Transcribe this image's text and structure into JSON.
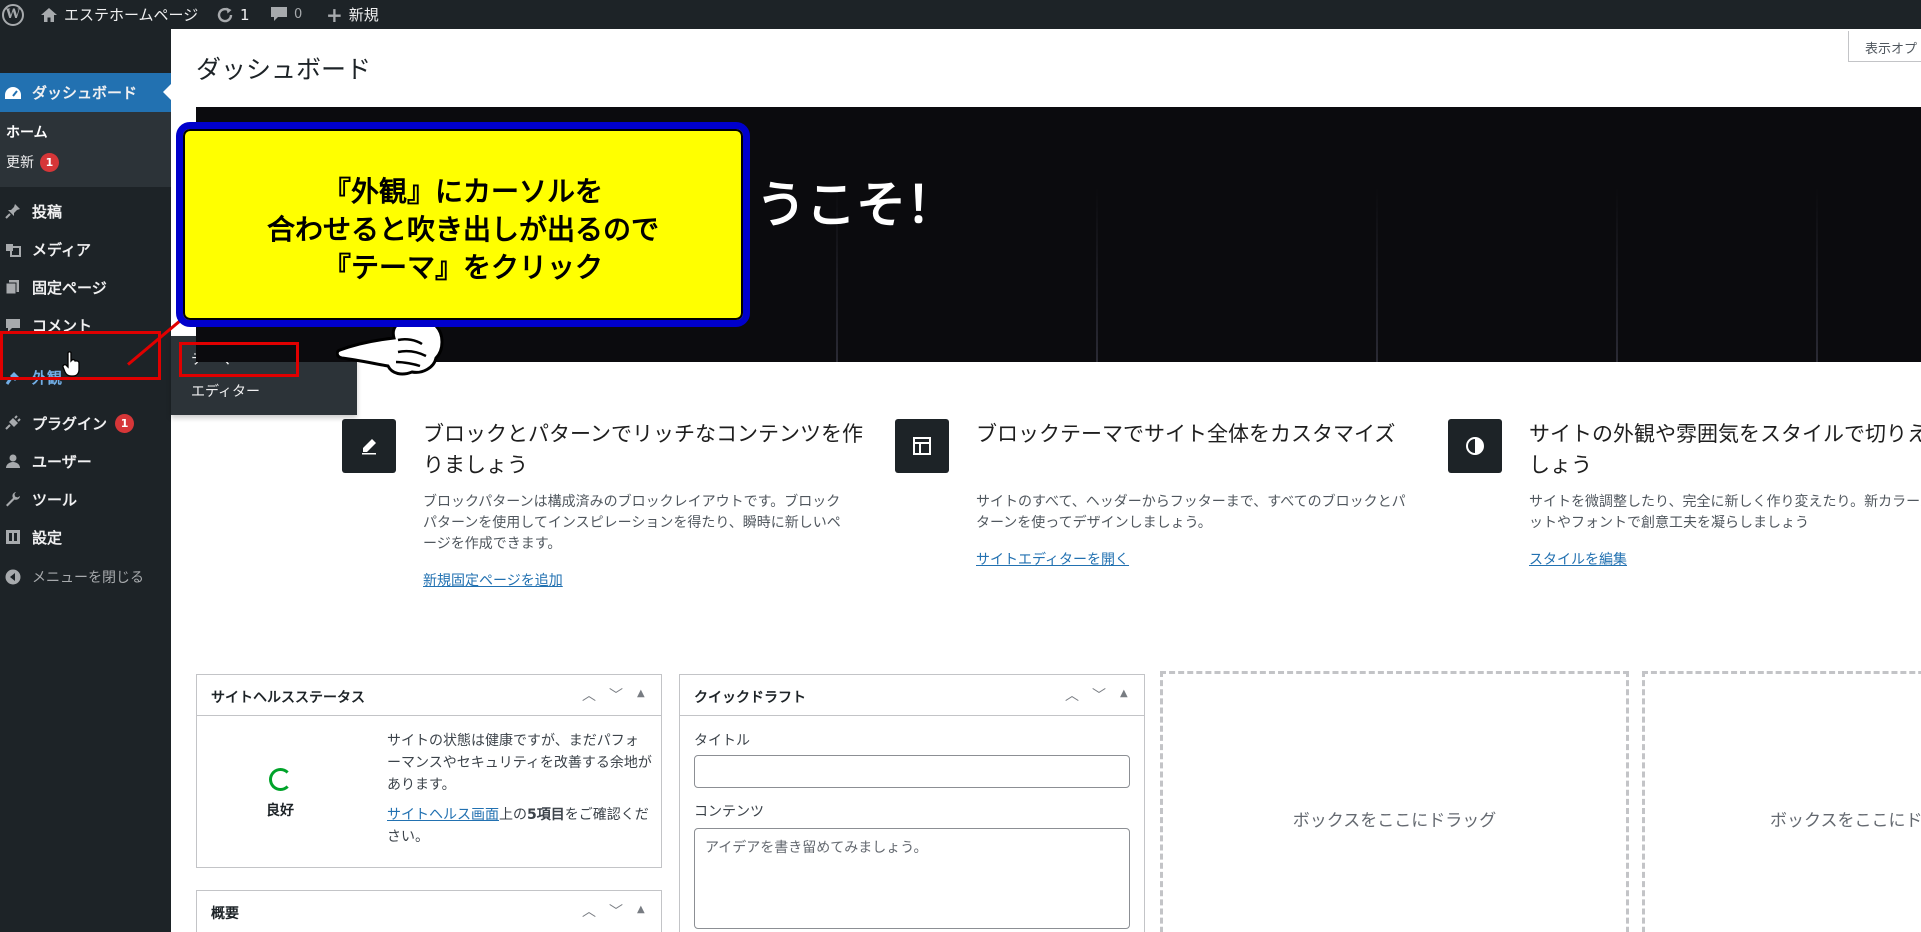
{
  "adminbar": {
    "site_name": "エステホームページ",
    "updates_count": "1",
    "comments_count": "0",
    "new_label": "新規"
  },
  "sidebar": {
    "dashboard": "ダッシュボード",
    "sub_home": "ホーム",
    "sub_updates": "更新",
    "updates_badge": "1",
    "items": [
      {
        "label": "投稿",
        "icon": "pin-icon"
      },
      {
        "label": "メディア",
        "icon": "media-icon"
      },
      {
        "label": "固定ページ",
        "icon": "page-icon"
      },
      {
        "label": "コメント",
        "icon": "comment-icon"
      },
      {
        "label": "外観",
        "icon": "brush-icon"
      },
      {
        "label": "プラグイン",
        "icon": "plugin-icon",
        "badge": "1"
      },
      {
        "label": "ユーザー",
        "icon": "user-icon"
      },
      {
        "label": "ツール",
        "icon": "wrench-icon"
      },
      {
        "label": "設定",
        "icon": "settings-icon"
      }
    ],
    "collapse": "メニューを閉じる"
  },
  "flyout": {
    "themes": "テーマ",
    "editor": "エディター"
  },
  "main": {
    "title": "ダッシュボード",
    "screen_options": "表示オプ",
    "welcome_title": "うこそ！"
  },
  "features": [
    {
      "title": "ブロックとパターンでリッチなコンテンツを作りましょう",
      "desc": "ブロックパターンは構成済みのブロックレイアウトです。ブロックパターンを使用してインスピレーションを得たり、瞬時に新しいページを作成できます。",
      "link": "新規固定ページを追加"
    },
    {
      "title": "ブロックテーマでサイト全体をカスタマイズ",
      "desc": "サイトのすべて、ヘッダーからフッターまで、すべてのブロックとパターンを使ってデザインしましょう。",
      "link": "サイトエディターを開く"
    },
    {
      "title": "サイトの外観や雰囲気をスタイルで切りえましょう",
      "desc": "サイトを微調整したり、完全に新しく作り変えたり。新カラーパレットやフォントで創意工夫を凝らしましょう",
      "link": "スタイルを編集"
    }
  ],
  "site_health": {
    "title": "サイトヘルスステータス",
    "status": "良好",
    "text": "サイトの状態は健康ですが、まだパフォーマンスやセキュリティを改善する余地があります。",
    "link": "サイトヘルス画面",
    "text_after_link": "上の",
    "items": "5項目",
    "text_end": "をご確認ください。"
  },
  "overview": {
    "title": "概要"
  },
  "quick_draft": {
    "title": "クイックドラフト",
    "title_label": "タイトル",
    "content_label": "コンテンツ",
    "content_placeholder": "アイデアを書き留めてみましょう。"
  },
  "dropzones": [
    "ボックスをここにドラッグ",
    "ボックスをここにド"
  ],
  "annotation": {
    "line1": "『外観』にカーソルを",
    "line2": "合わせると吹き出しが出るので",
    "line3": "『テーマ』をクリック"
  },
  "colors": {
    "admin_dark": "#1d2327",
    "accent": "#2271b1",
    "badge": "#d63638",
    "callout_fill": "#ffff00",
    "callout_border": "#0000cc",
    "highlight": "#e00000"
  }
}
